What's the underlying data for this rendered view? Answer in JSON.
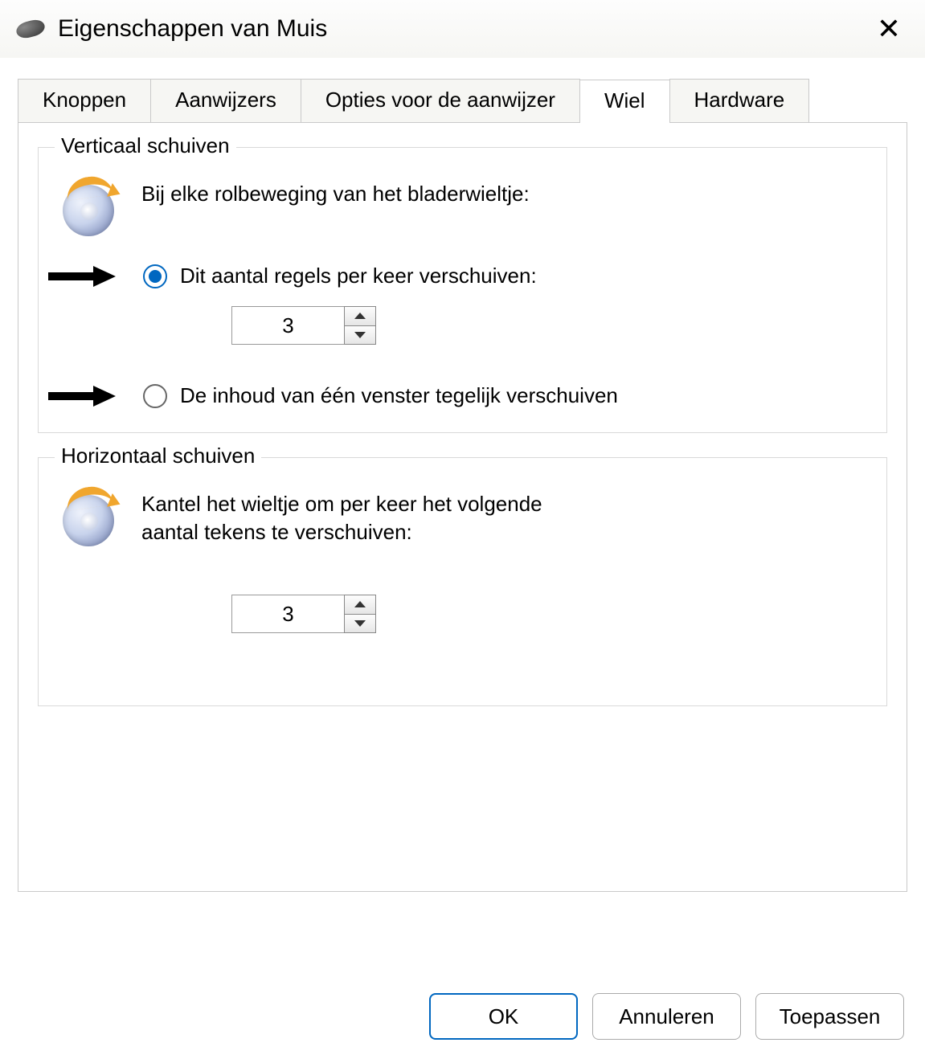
{
  "window": {
    "title": "Eigenschappen van Muis"
  },
  "tabs": [
    {
      "label": "Knoppen",
      "active": false
    },
    {
      "label": "Aanwijzers",
      "active": false
    },
    {
      "label": "Opties voor de aanwijzer",
      "active": false
    },
    {
      "label": "Wiel",
      "active": true
    },
    {
      "label": "Hardware",
      "active": false
    }
  ],
  "vertical": {
    "legend": "Verticaal schuiven",
    "description": "Bij elke rolbeweging van het bladerwieltje:",
    "option1": "Dit aantal regels per keer verschuiven:",
    "option2": "De inhoud van één venster tegelijk verschuiven",
    "lines": "3"
  },
  "horizontal": {
    "legend": "Horizontaal schuiven",
    "description": "Kantel het wieltje om per keer het volgende aantal tekens te verschuiven:",
    "chars": "3"
  },
  "buttons": {
    "ok": "OK",
    "cancel": "Annuleren",
    "apply": "Toepassen"
  }
}
